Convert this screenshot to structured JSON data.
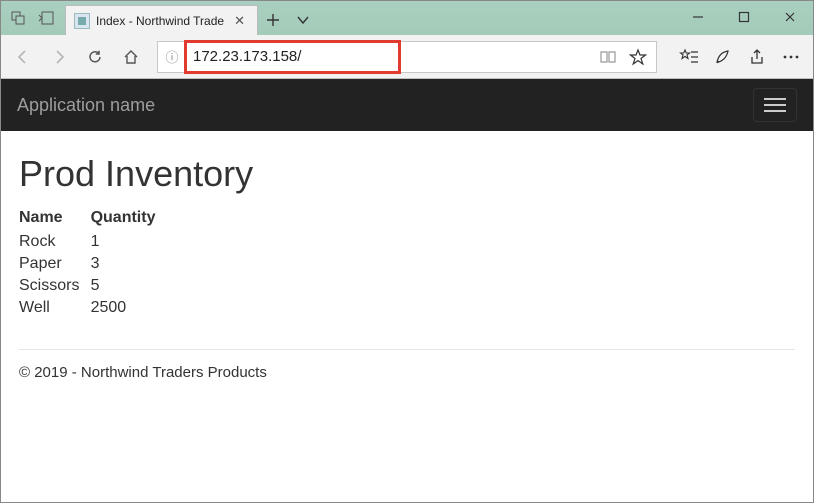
{
  "browser": {
    "tab_title": "Index - Northwind Trade",
    "address": "172.23.173.158/"
  },
  "app": {
    "brand": "Application name",
    "heading": "Prod Inventory",
    "columns": {
      "name": "Name",
      "quantity": "Quantity"
    },
    "rows": [
      {
        "name": "Rock",
        "quantity": "1"
      },
      {
        "name": "Paper",
        "quantity": "3"
      },
      {
        "name": "Scissors",
        "quantity": "5"
      },
      {
        "name": "Well",
        "quantity": "2500"
      }
    ],
    "footer": "© 2019 - Northwind Traders Products"
  }
}
